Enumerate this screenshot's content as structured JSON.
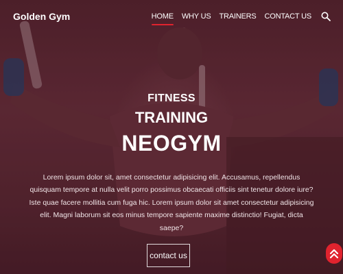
{
  "brand": "Golden Gym",
  "nav": {
    "items": [
      "HOME",
      "WHY US",
      "TRAINERS",
      "CONTACT US"
    ],
    "active_index": 0,
    "search_icon": "search-icon"
  },
  "hero": {
    "line1": "FITNESS",
    "line2": "TRAINING",
    "line3": "NEOGYM",
    "paragraph": "Lorem ipsum dolor sit, amet consectetur adipisicing elit. Accusamus, repellendus quisquam tempore at nulla velit porro possimus obcaecati officiis sint tenetur dolore iure? Iste quae facere mollitia cum fuga hic. Lorem ipsum dolor sit amet consectetur adipisicing elit. Magni laborum sit eos minus tempore sapiente maxime distinctio! Fugiat, dicta saepe?",
    "cta_label": "contact us"
  },
  "scroll_top_icon": "double-chevron-up-icon",
  "colors": {
    "accent": "#e0232e",
    "overlay": "#5a2a34"
  }
}
